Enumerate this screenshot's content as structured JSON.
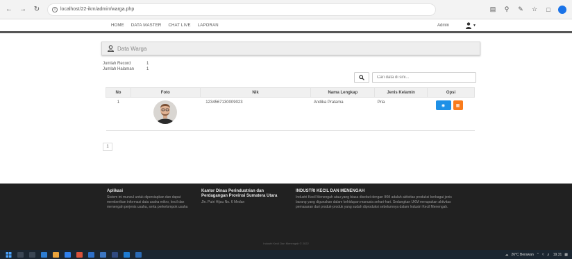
{
  "browser": {
    "url": "localhost/22-ikm/admin/warga.php"
  },
  "nav": {
    "items": [
      "HOME",
      "DATA MASTER",
      "CHAT LIVE",
      "LAPORAN"
    ],
    "user": "Admin"
  },
  "panel": {
    "title": "Data Warga"
  },
  "stats": {
    "record_label": "Jumlah Record",
    "record_value": "1",
    "pages_label": "Jumlah Halaman",
    "pages_value": "1"
  },
  "search": {
    "placeholder": "Cari data di sini..."
  },
  "table": {
    "headers": [
      "No",
      "Foto",
      "Nik",
      "Nama Lengkap",
      "Jenis Kelamin",
      "Opsi"
    ],
    "rows": [
      {
        "no": "1",
        "nik": "1234567130009023",
        "nama": "Andika Pratama",
        "jk": "Pria"
      }
    ]
  },
  "pagination": {
    "current": "1"
  },
  "footer": {
    "col1_title": "Aplikasi",
    "col1_text": "Sistem ini muncul untuk dipersiapkan dan dapat memberikan informasi data usaha mikro, kecil dan menengah perjenis usaha, serta perkelompok usaha",
    "col2_title": "Kantor Dinas Perindustrian dan Perdagangan Provinsi Sumatera Utara",
    "col2_text": "Jln. Putri Hijau No. 6 Medan",
    "col3_title": "INDUSTRI KECIL DAN MENENGAH",
    "col3_text": "Industri Kecil Menengah atau yang biasa disebut dengan IKM adalah aktivitas produksi berbagai jenis barang yang digunakan dalam kehidupan manusia sehari-hari. Sedangkan UKM merupakan aktivitas pemasaran dari produk-produk yang sudah diproduksi sebelumnya dalam Industri Kecil Menengah.",
    "copyright": "Industri Kecil Dan Menengah © 2022"
  },
  "taskbar": {
    "weather": "26°C Berawan",
    "time": "19.31"
  },
  "colors": {
    "view_button": "#1e90e6",
    "delete_button": "#f97b1c",
    "footer_bg": "#212121"
  }
}
